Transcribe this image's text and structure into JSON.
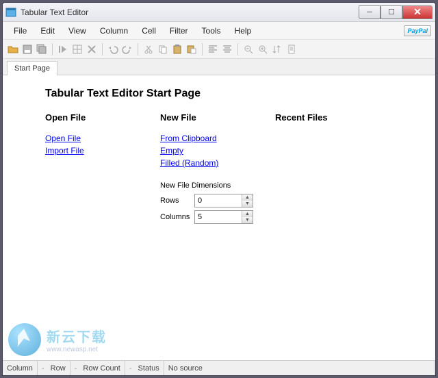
{
  "window": {
    "title": "Tabular Text Editor"
  },
  "menu": {
    "file": "File",
    "edit": "Edit",
    "view": "View",
    "column": "Column",
    "cell": "Cell",
    "filter": "Filter",
    "tools": "Tools",
    "help": "Help"
  },
  "paypal": {
    "p1": "Pay",
    "p2": "Pal"
  },
  "tabs": {
    "start": "Start Page"
  },
  "start": {
    "heading": "Tabular Text Editor Start Page",
    "open": {
      "title": "Open File",
      "open_file": "Open File",
      "import_file": "Import File"
    },
    "newf": {
      "title": "New File",
      "from_clipboard": "From Clipboard",
      "empty": "Empty",
      "filled": "Filled (Random)"
    },
    "recent": {
      "title": "Recent Files"
    },
    "dims": {
      "label": "New File Dimensions",
      "rows_label": "Rows",
      "cols_label": "Columns",
      "rows_value": "0",
      "cols_value": "5"
    }
  },
  "status": {
    "column_label": "Column",
    "row_label": "Row",
    "row_count_label": "Row Count",
    "status_label": "Status",
    "dash": "-",
    "source": "No source"
  },
  "watermark": {
    "big": "新云下载",
    "small": "www.newasp.net"
  }
}
